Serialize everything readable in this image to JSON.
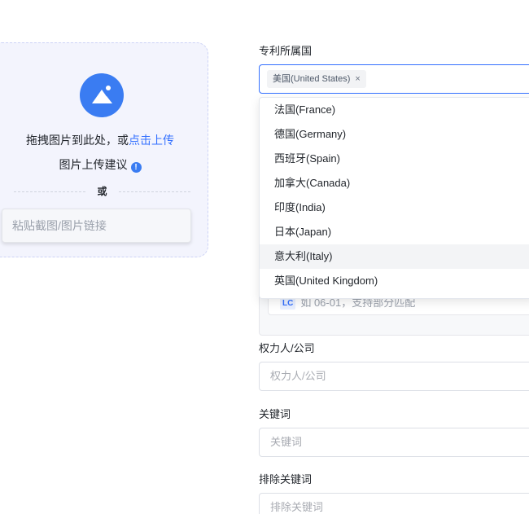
{
  "upload": {
    "drag_text": "拖拽图片到此处，或",
    "click_link": "点击上传",
    "suggest_text": "图片上传建议",
    "info_icon": "!",
    "or_text": "或",
    "paste_placeholder": "粘贴截图/图片链接",
    "accent_color": "#3a7cf2"
  },
  "form": {
    "country": {
      "label": "专利所属国",
      "selected_tag": "美国(United States)",
      "tag_close": "×"
    },
    "date": {
      "badge": "LC",
      "placeholder": "如 06-01，支持部分匹配"
    },
    "assignee": {
      "label": "权力人/公司",
      "placeholder": "权力人/公司"
    },
    "keyword": {
      "label": "关键词",
      "placeholder": "关键词"
    },
    "exclude_keyword": {
      "label": "排除关键词",
      "placeholder": "排除关键词"
    }
  },
  "dropdown": {
    "items": [
      "法国(France)",
      "德国(Germany)",
      "西班牙(Spain)",
      "加拿大(Canada)",
      "印度(India)",
      "日本(Japan)",
      "意大利(Italy)",
      "英国(United Kingdom)"
    ],
    "hovered_index": 6
  }
}
